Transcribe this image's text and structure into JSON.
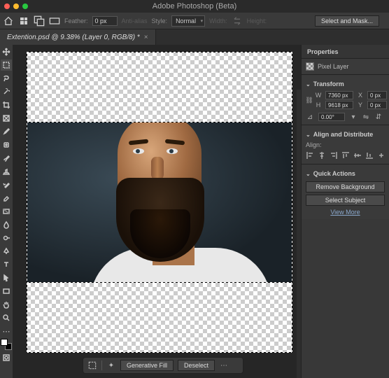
{
  "app": {
    "title": "Adobe Photoshop (Beta)"
  },
  "optbar": {
    "feather_label": "Feather:",
    "feather_value": "0 px",
    "antialias_label": "Anti-alias",
    "style_label": "Style:",
    "style_value": "Normal",
    "width_label": "Width:",
    "height_label": "Height:",
    "select_mask": "Select and Mask..."
  },
  "tab": {
    "title": "Extention.psd @ 9.38% (Layer 0, RGB/8) *"
  },
  "ctx": {
    "genfill": "Generative Fill",
    "deselect": "Deselect"
  },
  "props": {
    "title": "Properties",
    "layer_type": "Pixel Layer",
    "transform": {
      "head": "Transform",
      "w_label": "W",
      "w_value": "7360 px",
      "h_label": "H",
      "h_value": "9618 px",
      "x_label": "X",
      "x_value": "0 px",
      "y_label": "Y",
      "y_value": "0 px",
      "angle": "0.00°"
    },
    "align": {
      "head": "Align and Distribute",
      "sub": "Align:"
    },
    "qa": {
      "head": "Quick Actions",
      "remove_bg": "Remove Background",
      "select_subject": "Select Subject",
      "view_more": "View More"
    }
  }
}
